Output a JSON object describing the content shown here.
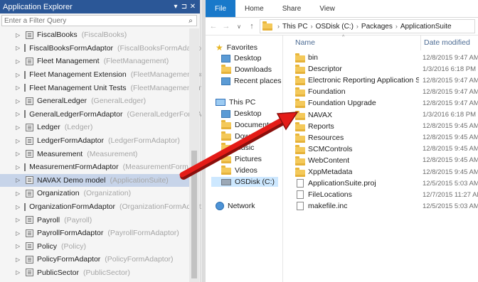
{
  "app_explorer": {
    "title": "Application Explorer",
    "title_buttons": [
      "▾",
      "⊐",
      "✕"
    ],
    "filter_placeholder": "Enter a Filter Query",
    "items": [
      {
        "name": "FiscalBooks",
        "model": "(FiscalBooks)"
      },
      {
        "name": "FiscalBooksFormAdaptor",
        "model": "(FiscalBooksFormAdaptor)"
      },
      {
        "name": "Fleet Management",
        "model": "(FleetManagement)"
      },
      {
        "name": "Fleet Management Extension",
        "model": "(FleetManagementExtension)"
      },
      {
        "name": "Fleet Management Unit Tests",
        "model": "(FleetManagementUnitTests)"
      },
      {
        "name": "GeneralLedger",
        "model": "(GeneralLedger)"
      },
      {
        "name": "GeneralLedgerFormAdaptor",
        "model": "(GeneralLedgerFormAdaptor)"
      },
      {
        "name": "Ledger",
        "model": "(Ledger)"
      },
      {
        "name": "LedgerFormAdaptor",
        "model": "(LedgerFormAdaptor)"
      },
      {
        "name": "Measurement",
        "model": "(Measurement)"
      },
      {
        "name": "MeasurementFormAdaptor",
        "model": "(MeasurementFormAdaptor)"
      },
      {
        "name": "NAVAX Demo model",
        "model": "(ApplicationSuite)"
      },
      {
        "name": "Organization",
        "model": "(Organization)"
      },
      {
        "name": "OrganizationFormAdaptor",
        "model": "(OrganizationFormAdaptor)"
      },
      {
        "name": "Payroll",
        "model": "(Payroll)"
      },
      {
        "name": "PayrollFormAdaptor",
        "model": "(PayrollFormAdaptor)"
      },
      {
        "name": "Policy",
        "model": "(Policy)"
      },
      {
        "name": "PolicyFormAdaptor",
        "model": "(PolicyFormAdaptor)"
      },
      {
        "name": "PublicSector",
        "model": "(PublicSector)"
      }
    ]
  },
  "file_explorer": {
    "ribbon_tabs": [
      "File",
      "Home",
      "Share",
      "View"
    ],
    "breadcrumb": [
      "This PC",
      "OSDisk (C:)",
      "Packages",
      "ApplicationSuite"
    ],
    "nav_pane": {
      "favorites": "Favorites",
      "desktop": "Desktop",
      "downloads": "Downloads",
      "recent": "Recent places",
      "this_pc": "This PC",
      "pc_desktop": "Desktop",
      "pc_documents": "Documents",
      "pc_downloads": "Downlo",
      "pc_music": "Music",
      "pc_pictures": "Pictures",
      "pc_videos": "Videos",
      "osdisk": "OSDisk (C:)",
      "network": "Network"
    },
    "columns": {
      "name": "Name",
      "date": "Date modified"
    },
    "files": [
      {
        "name": "bin",
        "date": "12/8/2015 9:47 AM",
        "type": "folder"
      },
      {
        "name": "Descriptor",
        "date": "1/3/2016 6:18 PM",
        "type": "folder"
      },
      {
        "name": "Electronic Reporting Application Suite Int...",
        "date": "12/8/2015 9:47 AM",
        "type": "folder"
      },
      {
        "name": "Foundation",
        "date": "12/8/2015 9:47 AM",
        "type": "folder"
      },
      {
        "name": "Foundation Upgrade",
        "date": "12/8/2015 9:47 AM",
        "type": "folder"
      },
      {
        "name": "NAVAX",
        "date": "1/3/2016 6:18 PM",
        "type": "folder"
      },
      {
        "name": "Reports",
        "date": "12/8/2015 9:45 AM",
        "type": "folder"
      },
      {
        "name": "Resources",
        "date": "12/8/2015 9:45 AM",
        "type": "folder"
      },
      {
        "name": "SCMControls",
        "date": "12/8/2015 9:45 AM",
        "type": "folder"
      },
      {
        "name": "WebContent",
        "date": "12/8/2015 9:45 AM",
        "type": "folder"
      },
      {
        "name": "XppMetadata",
        "date": "12/8/2015 9:45 AM",
        "type": "folder"
      },
      {
        "name": "ApplicationSuite.proj",
        "date": "12/5/2015 5:03 AM",
        "type": "file"
      },
      {
        "name": "FileLocations",
        "date": "12/7/2015 11:27 AM",
        "type": "file"
      },
      {
        "name": "makefile.inc",
        "date": "12/5/2015 5:03 AM",
        "type": "file"
      }
    ]
  },
  "colors": {
    "title_bar": "#2b5797",
    "selection": "#c7d4e9",
    "arrow": "#e41b17",
    "file_tab": "#1979ca"
  }
}
